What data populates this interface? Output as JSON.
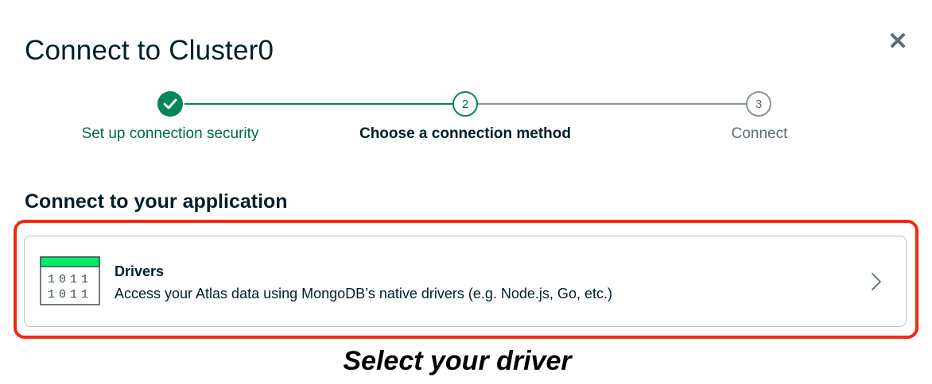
{
  "modal": {
    "title": "Connect to Cluster0"
  },
  "stepper": {
    "steps": [
      {
        "number": "",
        "label": "Set up connection security",
        "state": "completed"
      },
      {
        "number": "2",
        "label": "Choose a connection method",
        "state": "active"
      },
      {
        "number": "3",
        "label": "Connect",
        "state": "upcoming"
      }
    ]
  },
  "section": {
    "heading": "Connect to your application"
  },
  "driver_card": {
    "icon": "binary-window-icon",
    "title": "Drivers",
    "description": "Access your Atlas data using MongoDB’s native drivers (e.g. Node.js, Go, etc.)",
    "icon_text_line1": "1011",
    "icon_text_line2": "1011"
  },
  "annotation": {
    "caption": "Select your driver",
    "highlight_color": "#f0290f"
  },
  "colors": {
    "accent_green": "#00875a",
    "text_dark": "#001e2b",
    "text_muted": "#5c6c75"
  }
}
